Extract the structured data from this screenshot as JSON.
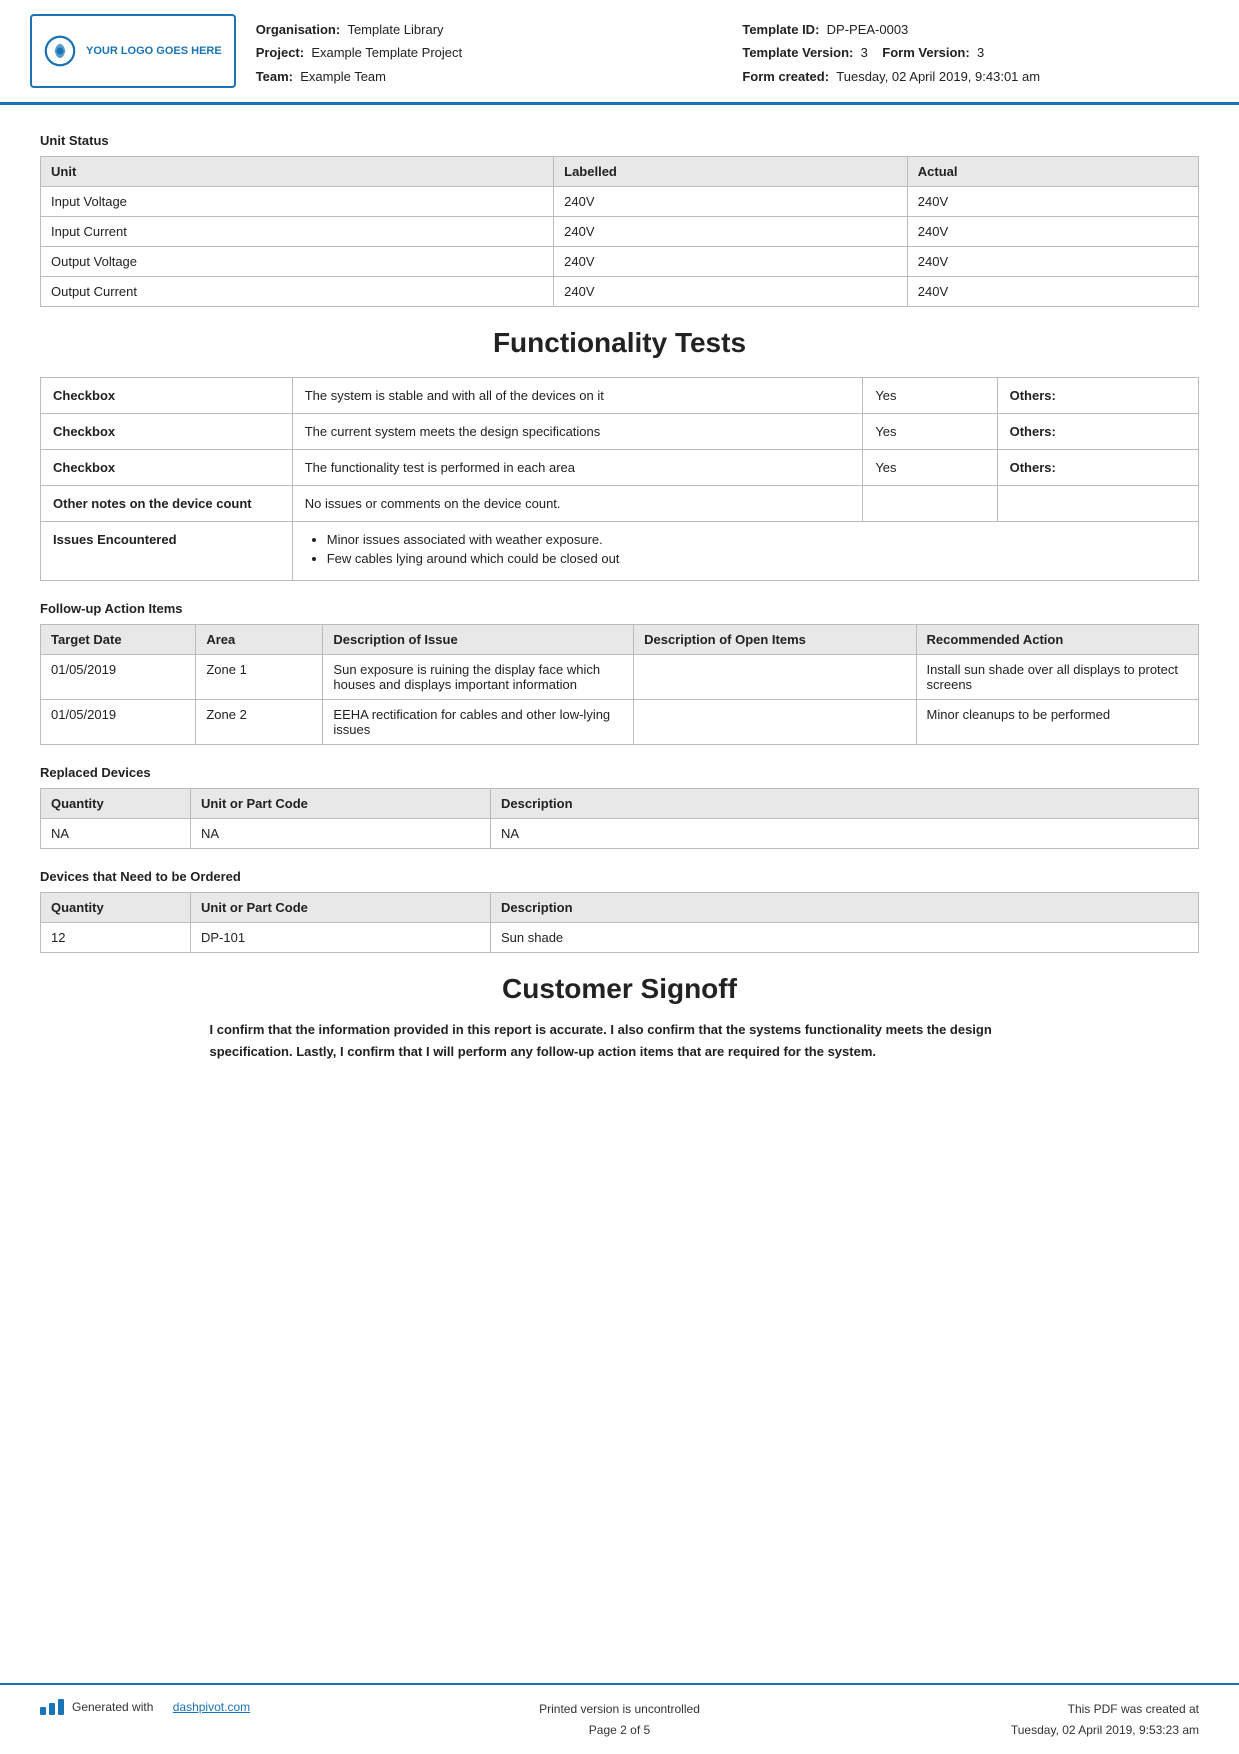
{
  "header": {
    "logo_text": "YOUR LOGO GOES HERE",
    "org_label": "Organisation:",
    "org_value": "Template Library",
    "project_label": "Project:",
    "project_value": "Example Template Project",
    "team_label": "Team:",
    "team_value": "Example Team",
    "template_id_label": "Template ID:",
    "template_id_value": "DP-PEA-0003",
    "template_version_label": "Template Version:",
    "template_version_value": "3",
    "form_version_label": "Form Version:",
    "form_version_value": "3",
    "form_created_label": "Form created:",
    "form_created_value": "Tuesday, 02 April 2019, 9:43:01 am"
  },
  "unit_status": {
    "section_title": "Unit Status",
    "columns": [
      "Unit",
      "Labelled",
      "Actual"
    ],
    "rows": [
      [
        "Input Voltage",
        "240V",
        "240V"
      ],
      [
        "Input Current",
        "240V",
        "240V"
      ],
      [
        "Output Voltage",
        "240V",
        "240V"
      ],
      [
        "Output Current",
        "240V",
        "240V"
      ]
    ]
  },
  "functionality": {
    "title": "Functionality Tests",
    "rows": [
      {
        "label": "Checkbox",
        "description": "The system is stable and with all of the devices on it",
        "value": "Yes",
        "others": "Others:"
      },
      {
        "label": "Checkbox",
        "description": "The current system meets the design specifications",
        "value": "Yes",
        "others": "Others:"
      },
      {
        "label": "Checkbox",
        "description": "The functionality test is performed in each area",
        "value": "Yes",
        "others": "Others:"
      },
      {
        "label": "Other notes on the device count",
        "description": "No issues or comments on the device count.",
        "value": "",
        "others": ""
      },
      {
        "label": "Issues Encountered",
        "bullets": [
          "Minor issues associated with weather exposure.",
          "Few cables lying around which could be closed out"
        ]
      }
    ]
  },
  "follow_up": {
    "title": "Follow-up Action Items",
    "columns": [
      "Target Date",
      "Area",
      "Description of Issue",
      "Description of Open Items",
      "Recommended Action"
    ],
    "rows": [
      {
        "target_date": "01/05/2019",
        "area": "Zone 1",
        "description": "Sun exposure is ruining the display face which houses and displays important information",
        "open_items": "",
        "recommended": "Install sun shade over all displays to protect screens"
      },
      {
        "target_date": "01/05/2019",
        "area": "Zone 2",
        "description": "EEHA rectification for cables and other low-lying issues",
        "open_items": "",
        "recommended": "Minor cleanups to be performed"
      }
    ]
  },
  "replaced_devices": {
    "title": "Replaced Devices",
    "columns": [
      "Quantity",
      "Unit or Part Code",
      "Description"
    ],
    "rows": [
      [
        "NA",
        "NA",
        "NA"
      ]
    ]
  },
  "devices_to_order": {
    "title": "Devices that Need to be Ordered",
    "columns": [
      "Quantity",
      "Unit or Part Code",
      "Description"
    ],
    "rows": [
      [
        "12",
        "DP-101",
        "Sun shade"
      ]
    ]
  },
  "signoff": {
    "title": "Customer Signoff",
    "text": "I confirm that the information provided in this report is accurate. I also confirm that the systems functionality meets the design specification. Lastly, I confirm that I will perform any follow-up action items that are required for the system."
  },
  "footer": {
    "generated_text": "Generated with",
    "dashpivot_link": "dashpivot.com",
    "center_line1": "Printed version is uncontrolled",
    "center_line2": "Page 2 of 5",
    "right_line1": "This PDF was created at",
    "right_line2": "Tuesday, 02 April 2019, 9:53:23 am"
  }
}
